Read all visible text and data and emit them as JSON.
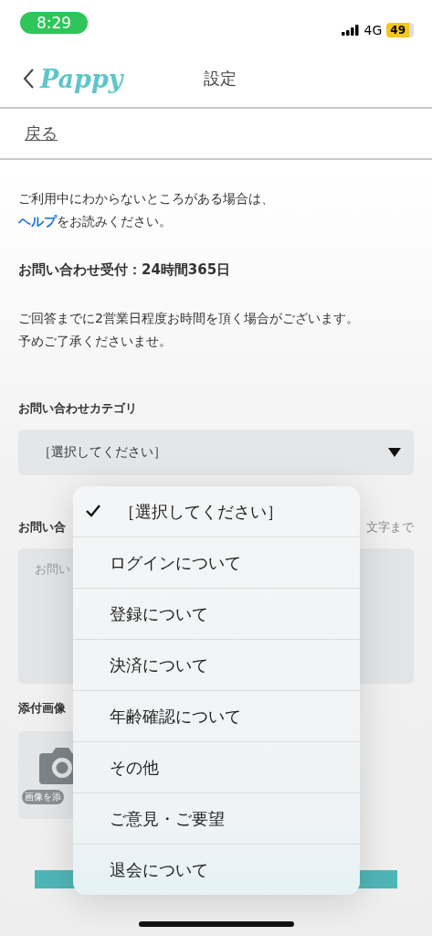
{
  "status_bar": {
    "time": "8:29",
    "network": "4G",
    "battery": "49"
  },
  "header": {
    "logo": "Pappy",
    "title": "設定"
  },
  "back_link": "戻る",
  "intro": {
    "before": "ご利用中にわからないところがある場合は、",
    "link": "ヘルプ",
    "after": "をお読みください。"
  },
  "hours": "お問い合わせ受付：24時間365日",
  "notice": [
    "ご回答までに2営業日程度お時間を頂く場合がございます。",
    "予めご了承くださいませ。"
  ],
  "category": {
    "label": "お問い合わせカテゴリ",
    "value": "［選択してください］"
  },
  "message": {
    "label": "お問い合",
    "counter": "文字まで",
    "placeholder": "お問い"
  },
  "attachment": {
    "label": "添付画像",
    "button": "画像を添"
  },
  "picker": [
    {
      "label": "［選択してください］",
      "selected": true
    },
    {
      "label": "ログインについて",
      "selected": false
    },
    {
      "label": "登録について",
      "selected": false
    },
    {
      "label": "決済について",
      "selected": false
    },
    {
      "label": "年齢確認について",
      "selected": false
    },
    {
      "label": "その他",
      "selected": false
    },
    {
      "label": "ご意見・ご要望",
      "selected": false
    },
    {
      "label": "退会について",
      "selected": false
    }
  ]
}
